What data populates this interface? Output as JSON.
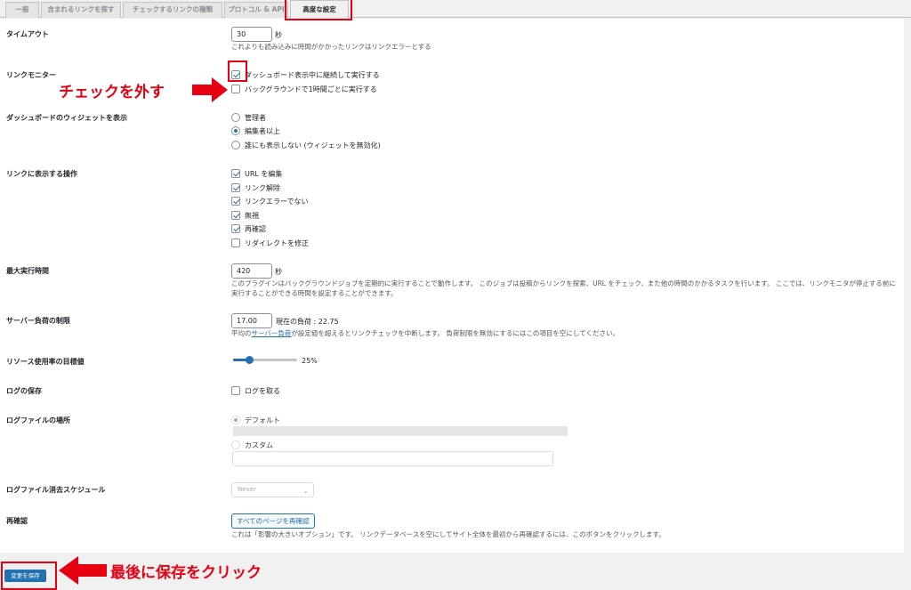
{
  "tabs": [
    {
      "label": "一般"
    },
    {
      "label": "含まれるリンクを探す"
    },
    {
      "label": "チェックするリンクの種類"
    },
    {
      "label": "プロトコル & API"
    },
    {
      "label": "高度な設定"
    }
  ],
  "timeout": {
    "label": "タイムアウト",
    "value": "30",
    "unit": "秒",
    "desc": "これよりも読み込みに時間がかかったリンクはリンクエラーとする"
  },
  "link_monitor": {
    "label": "リンクモニター",
    "option1": "ダッシュボード表示中に継続して実行する",
    "option2": "バックグラウンドで1時間ごとに実行する"
  },
  "dashboard_widget": {
    "label": "ダッシュボードのウィジェットを表示",
    "options": [
      "管理者",
      "編集者以上",
      "誰にも表示しない (ウィジェットを無効化)"
    ]
  },
  "link_actions": {
    "label": "リンクに表示する操作",
    "options": [
      "URL を編集",
      "リンク解除",
      "リンクエラーでない",
      "無視",
      "再確認",
      "リダイレクトを修正"
    ]
  },
  "max_exec": {
    "label": "最大実行時間",
    "value": "420",
    "unit": "秒",
    "desc": "このプラグインはバックグラウンドジョブを定期的に実行することで動作します。 このジョブは投稿からリンクを探索、URL をチェック、また他の時間のかかるタスクを行います。 ここでは、リンクモニタが停止する前に実行することができる時間を設定することができます。"
  },
  "server_load": {
    "label": "サーバー負荷の制限",
    "value": "17.00",
    "current": "現在の負荷 : 22.75",
    "desc_pre": "平均の",
    "desc_link": "サーバー負荷",
    "desc_post": "が設定値を超えるとリンクチェックを中断します。 負荷制限を無効にするにはこの項目を空にしてください。"
  },
  "resource_target": {
    "label": "リソース使用率の目標値",
    "value": "25%",
    "fraction": 0.25
  },
  "log_save": {
    "label": "ログの保存",
    "option": "ログを取る"
  },
  "log_file": {
    "label": "ログファイルの場所",
    "default": "デフォルト",
    "custom": "カスタム"
  },
  "log_clear": {
    "label": "ログファイル消去スケジュール",
    "value": "Never"
  },
  "recheck": {
    "label": "再確認",
    "button": "すべてのページを再確認",
    "desc": "これは「影響の大きいオプション」です。 リンクデータベースを空にしてサイト全体を最初から再確認するには、このボタンをクリックします。"
  },
  "save_button": "変更を保存",
  "annotations": {
    "uncheck": "チェックを外す",
    "save": "最後に保存をクリック"
  },
  "colors": {
    "accent": "#2271b1",
    "annotation": "#e60012"
  }
}
